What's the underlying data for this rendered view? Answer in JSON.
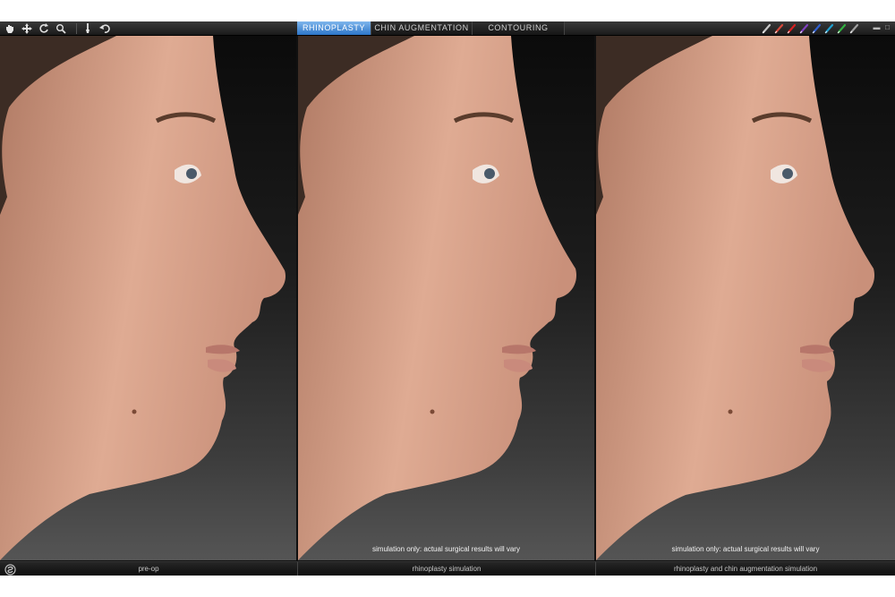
{
  "toolbar": {
    "left_tools": [
      {
        "icon": "hand-icon"
      },
      {
        "icon": "move-icon"
      },
      {
        "icon": "rotate-icon"
      },
      {
        "icon": "zoom-icon"
      },
      {
        "icon": "brush-icon"
      },
      {
        "icon": "undo-icon"
      }
    ],
    "tabs": [
      {
        "label": "RHINOPLASTY",
        "active": true
      },
      {
        "label": "CHIN AUGMENTATION",
        "active": false
      },
      {
        "label": "CONTOURING",
        "active": false
      }
    ],
    "pen_colors": [
      "#c8c8c8",
      "#d84a3c",
      "#d82020",
      "#8040c0",
      "#3060d0",
      "#20a0d0",
      "#30b040",
      "#a0a0a0"
    ]
  },
  "panels": [
    {
      "caption": "pre-op",
      "note": ""
    },
    {
      "caption": "rhinoplasty simulation",
      "note": "simulation only: actual surgical results will vary"
    },
    {
      "caption": "rhinoplasty and chin augmentation simulation",
      "note": "simulation only: actual surgical results will vary"
    }
  ],
  "colors": {
    "active_tab": "#3a86d8",
    "skin": "#d9a48c",
    "background": "#101010"
  }
}
